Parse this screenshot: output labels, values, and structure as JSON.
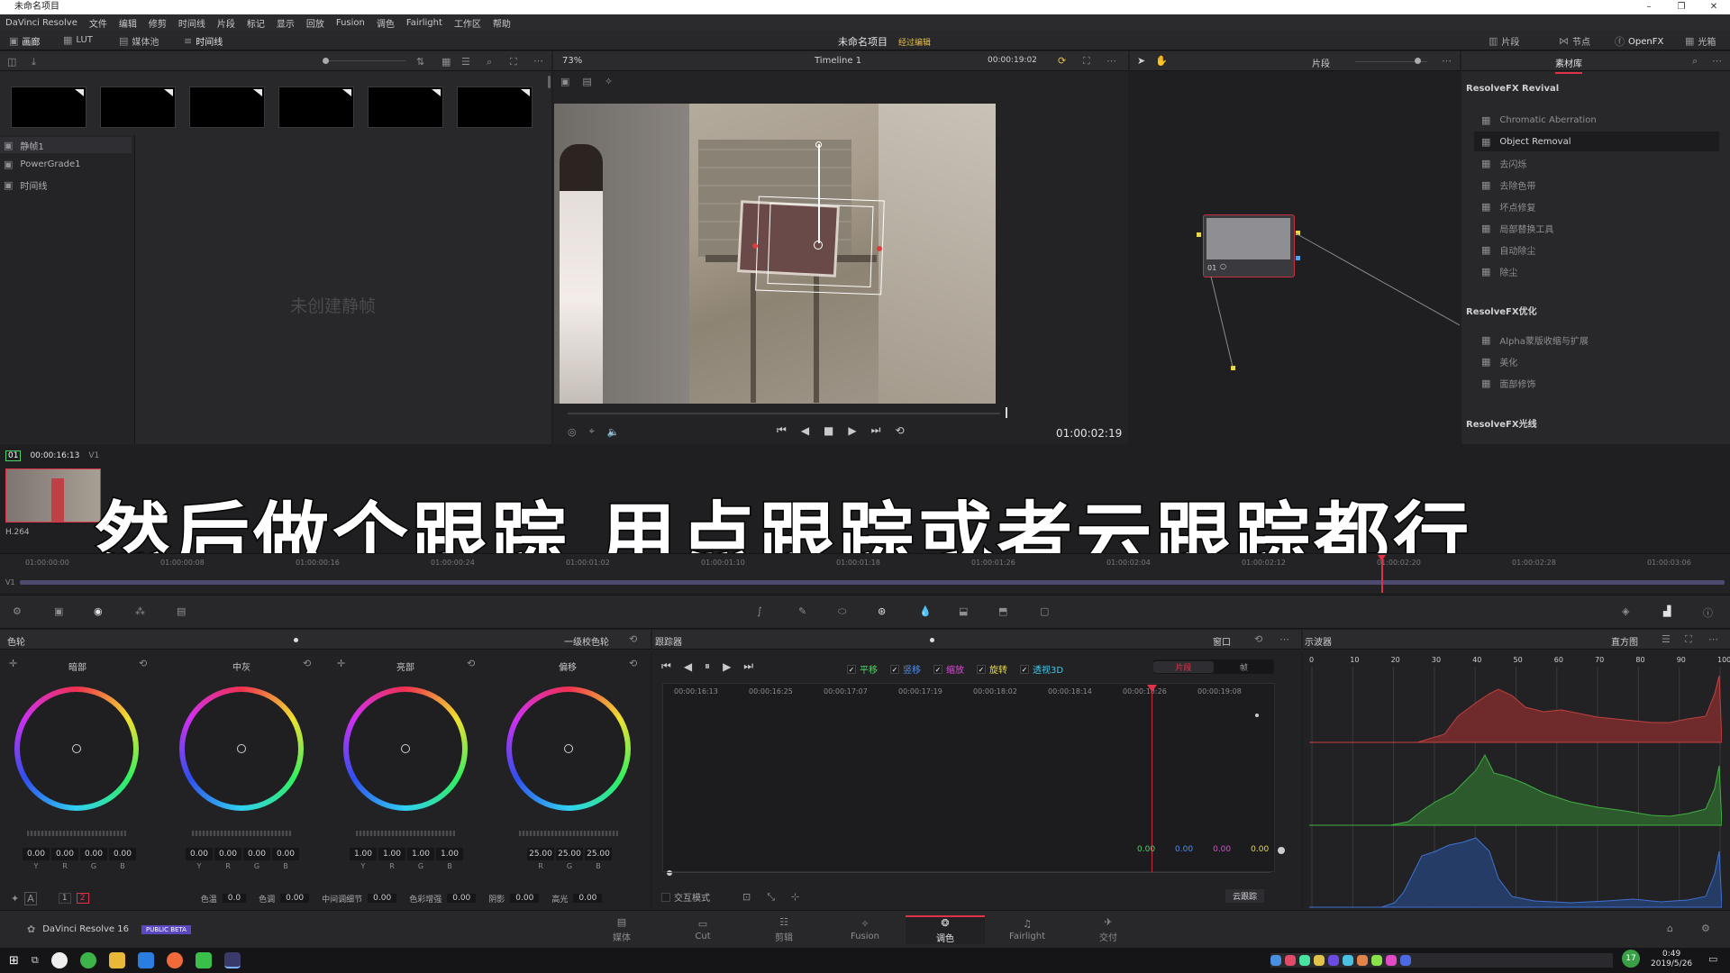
{
  "window": {
    "title": "未命名项目",
    "controls": [
      "–",
      "❐",
      "✕"
    ]
  },
  "menu": [
    "DaVinci Resolve",
    "文件",
    "编辑",
    "修剪",
    "时间线",
    "片段",
    "标记",
    "显示",
    "回放",
    "Fusion",
    "调色",
    "Fairlight",
    "工作区",
    "帮助"
  ],
  "toolbar": {
    "gallery": "画廊",
    "lut": "LUT",
    "media_pool": "媒体池",
    "timeline": "时间线",
    "project": "未命名项目",
    "status": "经过编辑",
    "clips": "片段",
    "nodes": "节点",
    "openfx": "OpenFX",
    "lightbox": "光箱"
  },
  "viewer": {
    "zoom": "73%",
    "timeline_name": "Timeline 1",
    "timecode_top": "00:00:19:02",
    "mode": "片段",
    "timecode": "01:00:02:19"
  },
  "gallery": {
    "albums": [
      "静帧1",
      "PowerGrade1",
      "时间线"
    ],
    "empty": "未创建静帧"
  },
  "clip": {
    "index": "01",
    "timecode": "00:00:16:13",
    "track": "V1",
    "codec": "H.264"
  },
  "node": {
    "label": "01"
  },
  "library": {
    "tab": "素材库",
    "group1": "ResolveFX Revival",
    "group1_items": [
      "Chromatic Aberration",
      "Object Removal",
      "去闪烁",
      "去除色带",
      "坏点修复",
      "局部替换工具",
      "自动除尘",
      "除尘"
    ],
    "group2": "ResolveFX优化",
    "group2_items": [
      "Alpha蒙版收缩与扩展",
      "美化",
      "面部修饰"
    ],
    "group3": "ResolveFX光线"
  },
  "subtitle": "然后做个跟踪 用点跟踪或者云跟踪都行",
  "timeline_ticks": [
    "01:00:00:00",
    "01:00:00:08",
    "01:00:00:16",
    "01:00:00:24",
    "01:00:01:02",
    "01:00:01:10",
    "01:00:01:18",
    "01:00:01:26",
    "01:00:02:04",
    "01:00:02:12",
    "01:00:02:20",
    "01:00:02:28",
    "01:00:03:06"
  ],
  "track_label": "V1",
  "color_wheels": {
    "title": "色轮",
    "mode": "一级校色轮",
    "wheels": [
      {
        "name": "暗部",
        "values": [
          "0.00",
          "0.00",
          "0.00",
          "0.00"
        ]
      },
      {
        "name": "中灰",
        "values": [
          "0.00",
          "0.00",
          "0.00",
          "0.00"
        ]
      },
      {
        "name": "亮部",
        "values": [
          "1.00",
          "1.00",
          "1.00",
          "1.00"
        ]
      },
      {
        "name": "偏移",
        "values": [
          "25.00",
          "25.00",
          "25.00"
        ]
      }
    ],
    "channels4": [
      "Y",
      "R",
      "G",
      "B"
    ],
    "channels3": [
      "R",
      "G",
      "B"
    ],
    "pages": [
      "1",
      "2"
    ],
    "bottom": [
      {
        "label": "色温",
        "value": "0.0"
      },
      {
        "label": "色调",
        "value": "0.00"
      },
      {
        "label": "中间调细节",
        "value": "0.00"
      },
      {
        "label": "色彩增强",
        "value": "0.00"
      },
      {
        "label": "阴影",
        "value": "0.00"
      },
      {
        "label": "高光",
        "value": "0.00"
      }
    ]
  },
  "tracker": {
    "title": "跟踪器",
    "checks": [
      {
        "label": "平移",
        "color": "#4fd26a"
      },
      {
        "label": "竖移",
        "color": "#4f8df0"
      },
      {
        "label": "缩放",
        "color": "#d64fd0"
      },
      {
        "label": "旋转",
        "color": "#e8d84a"
      },
      {
        "label": "透视3D",
        "color": "#42c7e6"
      }
    ],
    "mode_a": "片段",
    "mode_b": "帧",
    "window": "窗口",
    "ticks": [
      "00:00:16:13",
      "00:00:16:25",
      "00:00:17:07",
      "00:00:17:19",
      "00:00:18:02",
      "00:00:18:14",
      "00:00:18:26",
      "00:00:19:08"
    ],
    "readouts": [
      {
        "value": "0.00",
        "color": "#4fd26a"
      },
      {
        "value": "0.00",
        "color": "#4f8df0"
      },
      {
        "value": "0.00",
        "color": "#d64fd0"
      },
      {
        "value": "0.00",
        "color": "#e8d84a"
      }
    ],
    "interactive": "交互模式",
    "cloud": "云跟踪"
  },
  "scope": {
    "title": "示波器",
    "mode": "直方图",
    "ticks": [
      "0",
      "10",
      "20",
      "30",
      "40",
      "50",
      "60",
      "70",
      "80",
      "90",
      "100"
    ]
  },
  "app": {
    "name": "DaVinci Resolve 16",
    "badge": "PUBLIC BETA"
  },
  "pages": [
    "媒体",
    "Cut",
    "剪辑",
    "Fusion",
    "调色",
    "Fairlight",
    "交付"
  ],
  "taskbar": {
    "time": "0:49",
    "date": "2019/5/26",
    "notif": "17"
  }
}
